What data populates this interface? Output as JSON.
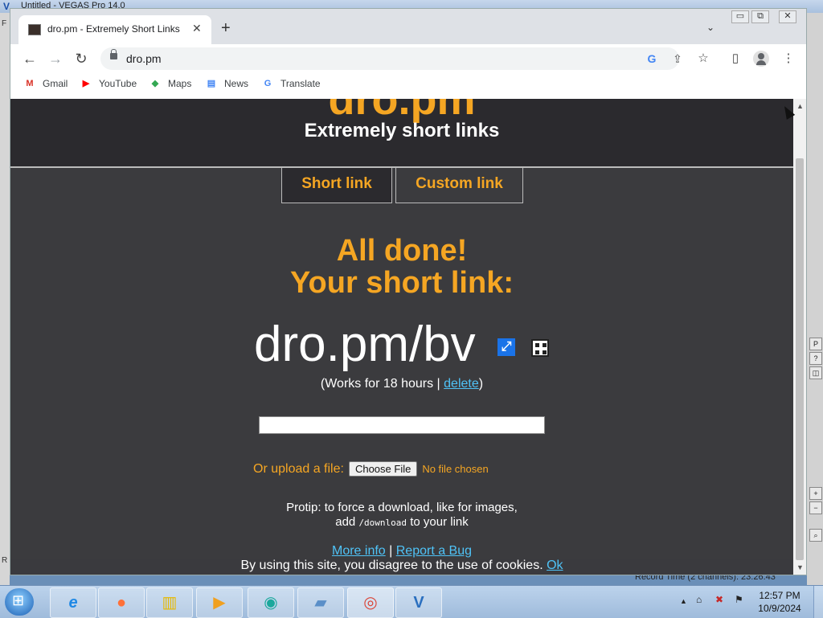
{
  "background_app": {
    "title": "Untitled - VEGAS Pro 14.0",
    "left_label_top": "F",
    "left_label_bottom": "R",
    "right_panel_button": "P",
    "record_time": "Record Time (2 channels): 23:26:43"
  },
  "browser": {
    "tab_title": "dro.pm - Extremely Short Links",
    "tab_close": "✕",
    "new_tab": "+",
    "tab_search": "⌄",
    "window_controls": [
      "▭",
      "⧉",
      "✕"
    ],
    "back": "←",
    "forward": "→",
    "reload": "↻",
    "url": "dro.pm",
    "google_icon": "G",
    "share_icon": "⇪",
    "star_icon": "☆",
    "sidepanel_icon": "▯",
    "menu_icon": "⋮",
    "bookmarks": [
      {
        "label": "Gmail",
        "icon": "M",
        "color": "#d93025"
      },
      {
        "label": "YouTube",
        "icon": "▶",
        "color": "#ff0000"
      },
      {
        "label": "Maps",
        "icon": "◆",
        "color": "#34a853"
      },
      {
        "label": "News",
        "icon": "▤",
        "color": "#4285f4"
      },
      {
        "label": "Translate",
        "icon": "G",
        "color": "#4285f4"
      }
    ]
  },
  "site": {
    "logo": "dro.pm",
    "tagline": "Extremely short links",
    "tabs": [
      "Short link",
      "Custom link"
    ],
    "done_line1": "All done!",
    "done_line2": "Your short link:",
    "short_link": "dro.pm/bv",
    "open_icon": "⤢",
    "works_prefix": "(Works for 18 hours | ",
    "delete_label": "delete",
    "works_suffix": ")",
    "url_input_value": "",
    "upload_label": "Or upload a file:",
    "choose_file": "Choose File",
    "no_file": "No file chosen",
    "protip_line1": "Protip: to force a download, like for images,",
    "protip_add": "add ",
    "protip_code": "/download",
    "protip_end": " to your link",
    "more_info": "More info",
    "separator": " | ",
    "report_bug": "Report a Bug",
    "cookie_text": "By using this site, you disagree to the use of cookies. ",
    "cookie_ok": "Ok"
  },
  "scrollbar": {
    "up": "▲",
    "down": "▼"
  },
  "taskbar": {
    "apps": [
      {
        "name": "ie",
        "icon": "e",
        "color": "#1e88e5"
      },
      {
        "name": "firefox",
        "icon": "●",
        "color": "#ff7139"
      },
      {
        "name": "explorer",
        "icon": "▥",
        "color": "#e6b800"
      },
      {
        "name": "media",
        "icon": "▶",
        "color": "#f0a020"
      },
      {
        "name": "app5",
        "icon": "◉",
        "color": "#1aa89c"
      },
      {
        "name": "app6",
        "icon": "▰",
        "color": "#5b8fc8"
      },
      {
        "name": "chrome",
        "icon": "◎",
        "color": "#db4437"
      },
      {
        "name": "vegas",
        "icon": "V",
        "color": "#2a6fbf"
      }
    ],
    "tray_icons": [
      "▲",
      "⌂",
      "✖",
      "⚑"
    ],
    "time": "12:57 PM",
    "date": "10/9/2024"
  }
}
